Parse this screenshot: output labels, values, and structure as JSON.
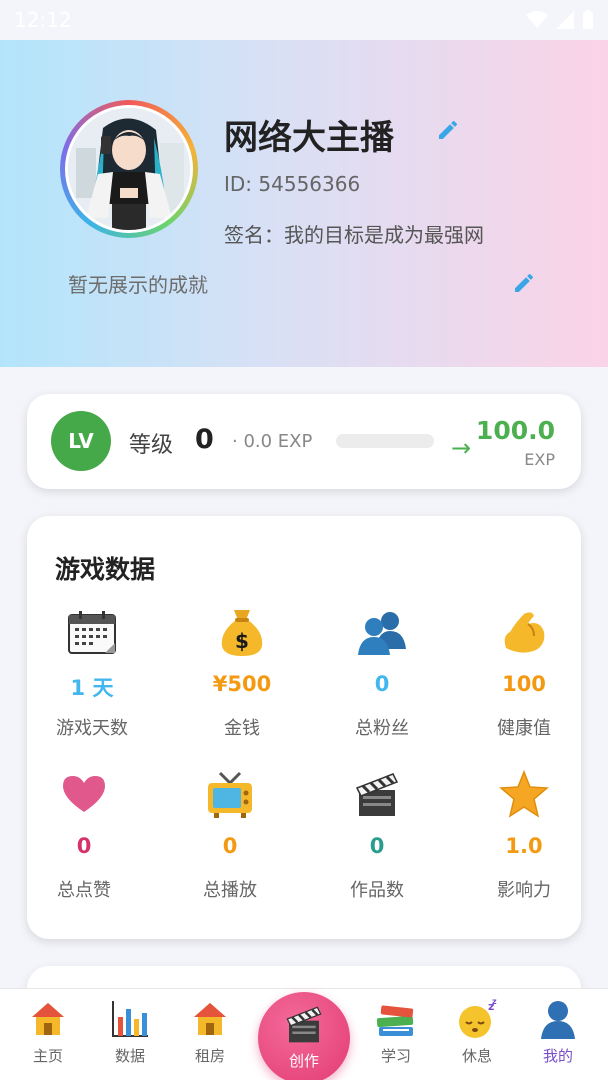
{
  "status_bar": {
    "time": "12:12"
  },
  "profile": {
    "nickname": "网络大主播",
    "id_text": "ID: 54556366",
    "signature": "签名：我的目标是成为最强网",
    "achievement": "暂无展示的成就"
  },
  "level": {
    "badge": "LV",
    "label": "等级",
    "value": "0",
    "current_exp": "· 0.0 EXP",
    "progress_fraction": 0.0,
    "target_exp": "100.0",
    "target_unit": "EXP",
    "arrow": "→"
  },
  "game_data": {
    "title": "游戏数据",
    "stats": [
      {
        "icon": "calendar-icon",
        "value": "1 天",
        "label": "游戏天数",
        "color": "#42b7ef"
      },
      {
        "icon": "money-bag-icon",
        "value": "¥500",
        "label": "金钱",
        "color": "#f39a12"
      },
      {
        "icon": "fans-icon",
        "value": "0",
        "label": "总粉丝",
        "color": "#42b7ef"
      },
      {
        "icon": "muscle-icon",
        "value": "100",
        "label": "健康值",
        "color": "#f39a12"
      },
      {
        "icon": "heart-icon",
        "value": "0",
        "label": "总点赞",
        "color": "#d6336c"
      },
      {
        "icon": "tv-icon",
        "value": "0",
        "label": "总播放",
        "color": "#f39a12"
      },
      {
        "icon": "clapper-icon",
        "value": "0",
        "label": "作品数",
        "color": "#2a9d8f"
      },
      {
        "icon": "star-icon",
        "value": "1.0",
        "label": "影响力",
        "color": "#f39a12"
      }
    ]
  },
  "nav": {
    "items": [
      {
        "icon": "home-icon",
        "label": "主页"
      },
      {
        "icon": "bar-chart-icon",
        "label": "数据"
      },
      {
        "icon": "house-icon",
        "label": "租房"
      },
      {
        "icon": "clapper-icon",
        "label": "创作"
      },
      {
        "icon": "books-icon",
        "label": "学习"
      },
      {
        "icon": "sleep-icon",
        "label": "休息"
      },
      {
        "icon": "user-icon",
        "label": "我的"
      }
    ],
    "active": "我的"
  },
  "colors": {
    "accent_green": "#4caf50",
    "create_pink": "#e23b72",
    "active_purple": "#7a4fc9",
    "edit_blue": "#3ba6e6"
  }
}
